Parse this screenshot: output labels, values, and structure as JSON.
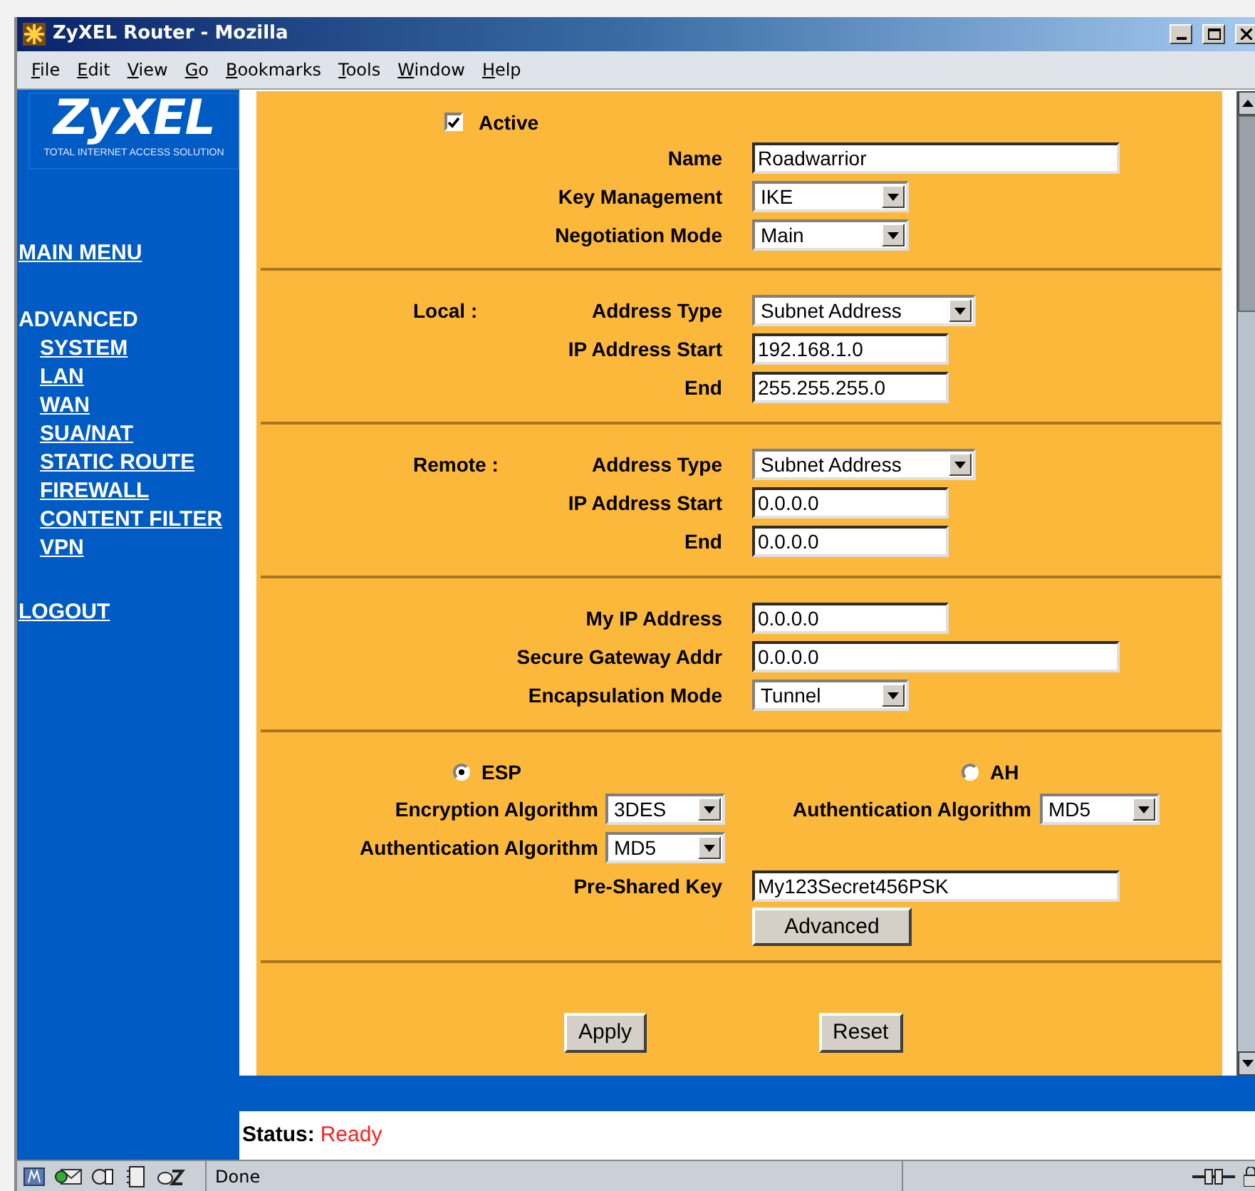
{
  "window": {
    "title": "ZyXEL Router - Mozilla"
  },
  "menu": [
    "File",
    "Edit",
    "View",
    "Go",
    "Bookmarks",
    "Tools",
    "Window",
    "Help"
  ],
  "sidebar": {
    "logo": "ZyXEL",
    "tagline": "TOTAL INTERNET ACCESS SOLUTION",
    "links": [
      {
        "label": "MAIN MENU",
        "kind": "link"
      },
      {
        "label": "ADVANCED",
        "kind": "heading"
      },
      {
        "label": "SYSTEM",
        "kind": "sublink"
      },
      {
        "label": "LAN",
        "kind": "sublink"
      },
      {
        "label": "WAN",
        "kind": "sublink"
      },
      {
        "label": "SUA/NAT",
        "kind": "sublink"
      },
      {
        "label": "STATIC ROUTE",
        "kind": "sublink"
      },
      {
        "label": "FIREWALL",
        "kind": "sublink"
      },
      {
        "label": "CONTENT FILTER",
        "kind": "sublink"
      },
      {
        "label": "VPN",
        "kind": "sublink"
      },
      {
        "label": "LOGOUT",
        "kind": "link"
      }
    ]
  },
  "form": {
    "sections": [
      {
        "kind": "fields",
        "rows": [
          {
            "kind": "checkbox",
            "label": "Active",
            "checked": true
          },
          {
            "kind": "long_field",
            "label": "Name",
            "value": "Roadwarrior"
          },
          {
            "kind": "select",
            "label": "Key Management",
            "value": "IKE"
          },
          {
            "kind": "select",
            "label": "Negotiation Mode",
            "value": "Main"
          }
        ]
      },
      {
        "kind": "fields",
        "group": "Local :",
        "rows": [
          {
            "kind": "select",
            "label": "Address Type",
            "value": "Subnet Address"
          },
          {
            "kind": "field",
            "label": "IP Address Start",
            "value": "192.168.1.0"
          },
          {
            "kind": "field",
            "label": "End",
            "value": "255.255.255.0"
          }
        ]
      },
      {
        "kind": "fields",
        "group": "Remote :",
        "rows": [
          {
            "kind": "select",
            "label": "Address Type",
            "value": "Subnet Address"
          },
          {
            "kind": "field",
            "label": "IP Address Start",
            "value": "0.0.0.0"
          },
          {
            "kind": "field",
            "label": "End",
            "value": "0.0.0.0"
          }
        ]
      },
      {
        "kind": "fields",
        "rows": [
          {
            "kind": "field",
            "label": "My IP Address",
            "value": "0.0.0.0"
          },
          {
            "kind": "long_field",
            "label": "Secure Gateway Addr",
            "value": "0.0.0.0"
          },
          {
            "kind": "select",
            "label": "Encapsulation Mode",
            "value": "Tunnel"
          }
        ]
      },
      {
        "kind": "protocol",
        "options": [
          {
            "label": "ESP",
            "selected": true,
            "rows": [
              {
                "label": "Encryption Algorithm",
                "value": "3DES"
              },
              {
                "label": "Authentication Algorithm",
                "value": "MD5"
              }
            ]
          },
          {
            "label": "AH",
            "selected": false,
            "rows": [
              {
                "label": "Authentication Algorithm",
                "value": "MD5"
              }
            ]
          }
        ],
        "key": {
          "label": "Pre-Shared Key",
          "value": "My123Secret456PSK"
        },
        "advanced": "Advanced"
      },
      {
        "kind": "actions",
        "buttons": [
          "Apply",
          "Reset"
        ]
      }
    ]
  },
  "status": {
    "label": "Status:",
    "value": "Ready"
  },
  "statusbar": {
    "text": "Done"
  }
}
